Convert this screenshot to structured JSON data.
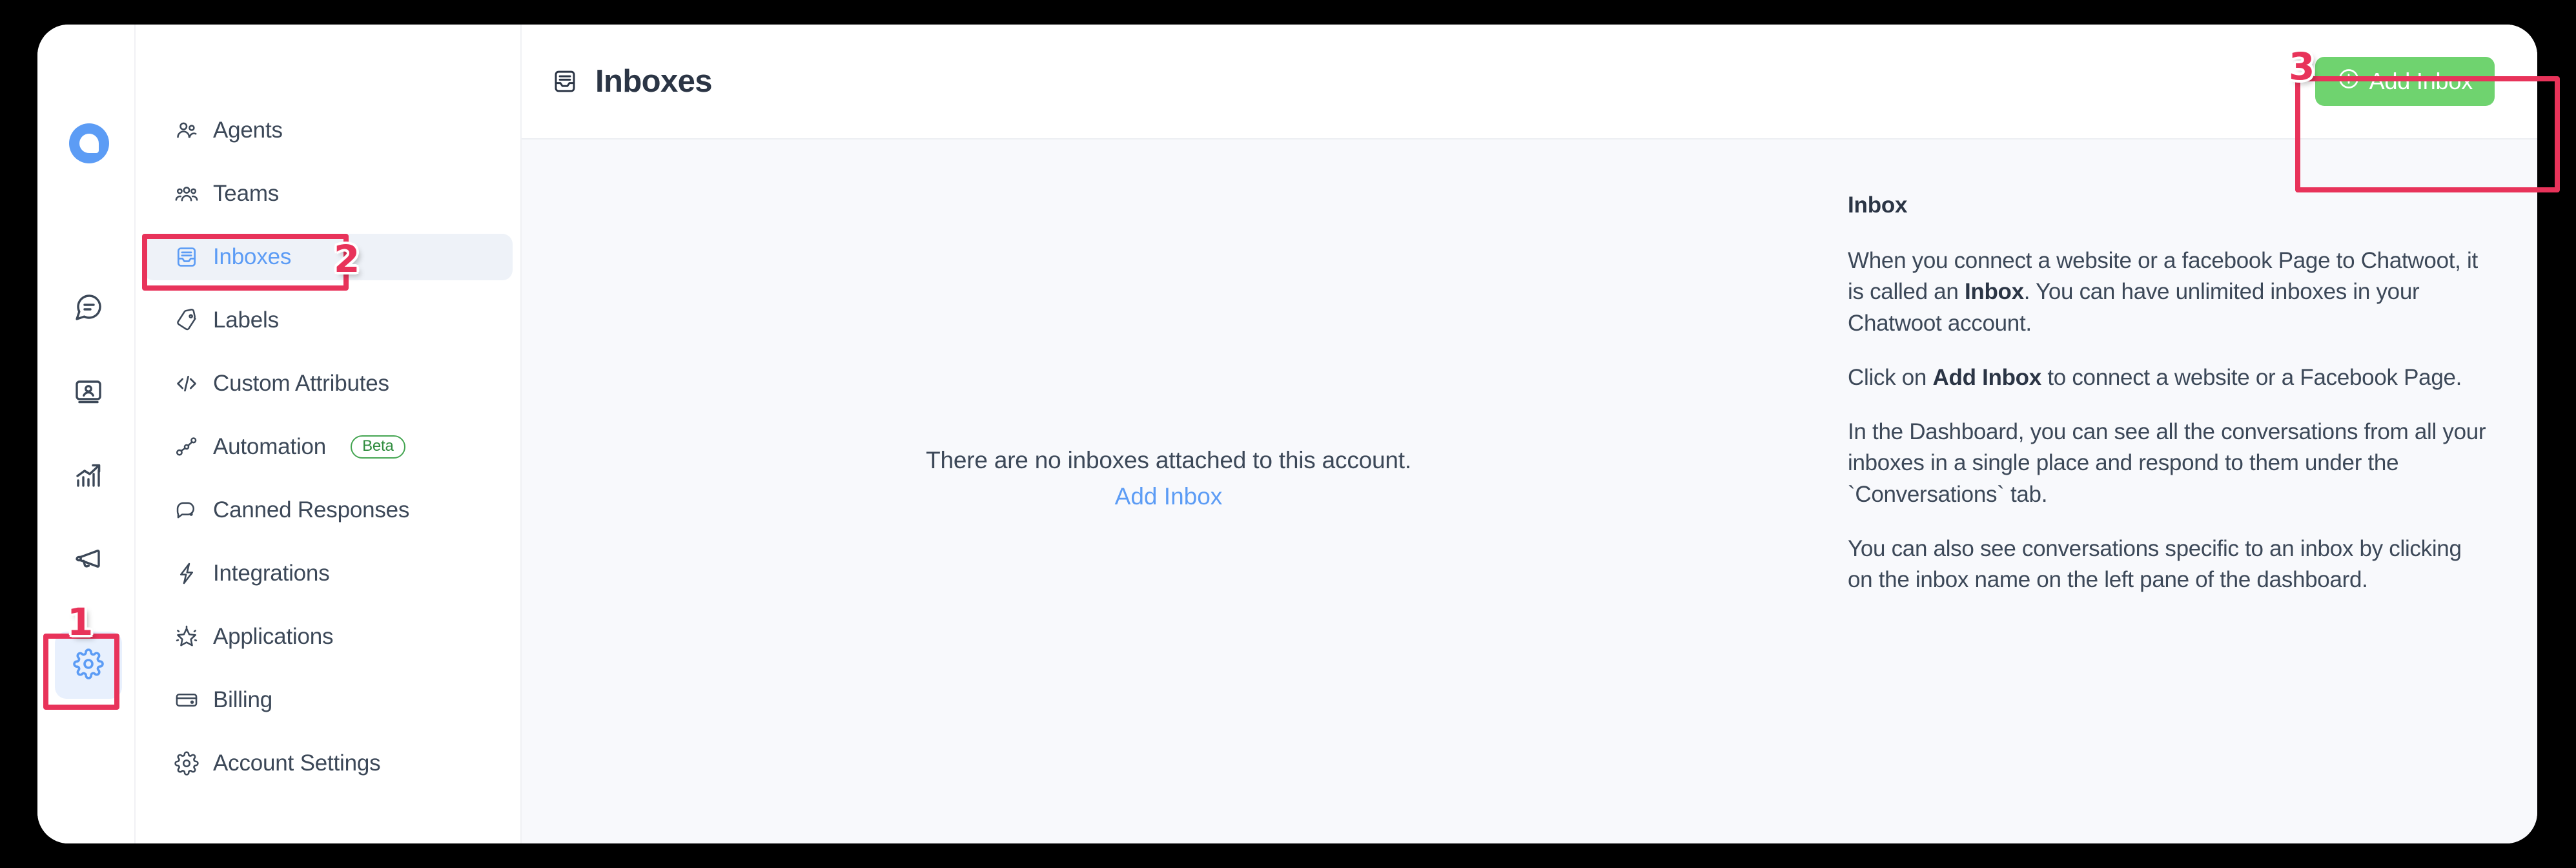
{
  "app": {
    "logo_icon": "chatwoot-logo-icon"
  },
  "icon_rail": {
    "items": [
      {
        "name": "conversations",
        "icon": "chat-bubble-icon",
        "active": false
      },
      {
        "name": "contacts",
        "icon": "contact-card-icon",
        "active": false
      },
      {
        "name": "reports",
        "icon": "bar-chart-up-icon",
        "active": false
      },
      {
        "name": "campaigns",
        "icon": "megaphone-icon",
        "active": false
      },
      {
        "name": "settings",
        "icon": "gear-icon",
        "active": true
      }
    ]
  },
  "sidebar": {
    "items": [
      {
        "label": "Agents",
        "icon": "people-icon",
        "selected": false,
        "badge": null
      },
      {
        "label": "Teams",
        "icon": "team-group-icon",
        "selected": false,
        "badge": null
      },
      {
        "label": "Inboxes",
        "icon": "inbox-icon",
        "selected": true,
        "badge": null
      },
      {
        "label": "Labels",
        "icon": "tag-icon",
        "selected": false,
        "badge": null
      },
      {
        "label": "Custom Attributes",
        "icon": "code-brackets-icon",
        "selected": false,
        "badge": null
      },
      {
        "label": "Automation",
        "icon": "automation-icon",
        "selected": false,
        "badge": "Beta"
      },
      {
        "label": "Canned Responses",
        "icon": "chat-dots-icon",
        "selected": false,
        "badge": null
      },
      {
        "label": "Integrations",
        "icon": "lightning-icon",
        "selected": false,
        "badge": null
      },
      {
        "label": "Applications",
        "icon": "star-burst-icon",
        "selected": false,
        "badge": null
      },
      {
        "label": "Billing",
        "icon": "credit-card-icon",
        "selected": false,
        "badge": null
      },
      {
        "label": "Account Settings",
        "icon": "gear-icon",
        "selected": false,
        "badge": null
      }
    ]
  },
  "header": {
    "title": "Inboxes",
    "title_icon": "inbox-icon",
    "add_inbox_label": "Add Inbox",
    "add_inbox_icon": "plus-circle-icon"
  },
  "empty_state": {
    "message": "There are no inboxes attached to this account.",
    "link_label": "Add Inbox"
  },
  "info_panel": {
    "heading": "Inbox",
    "paragraph_1_part_1": "When you connect a website or a facebook Page to Chatwoot, it is called an ",
    "paragraph_1_bold": "Inbox",
    "paragraph_1_part_2": ". You can have unlimited inboxes in your Chatwoot account.",
    "paragraph_2_part_1": "Click on ",
    "paragraph_2_bold": "Add Inbox",
    "paragraph_2_part_2": " to connect a website or a Facebook Page.",
    "paragraph_3": "In the Dashboard, you can see all the conversations from all your inboxes in a single place and respond to them under the `Conversations` tab.",
    "paragraph_4": "You can also see conversations specific to an inbox by clicking on the inbox name on the left pane of the dashboard."
  },
  "annotations": {
    "markers": [
      {
        "id": "1",
        "target": "settings-rail-icon"
      },
      {
        "id": "2",
        "target": "sidebar-item-inboxes"
      },
      {
        "id": "3",
        "target": "add-inbox-button"
      }
    ]
  },
  "colors": {
    "brand_blue": "#5c9cf5",
    "accent_green": "#6fd36f",
    "annotation_pink": "#e8335a",
    "text_dark": "#3c4858",
    "badge_green": "#44a551"
  }
}
